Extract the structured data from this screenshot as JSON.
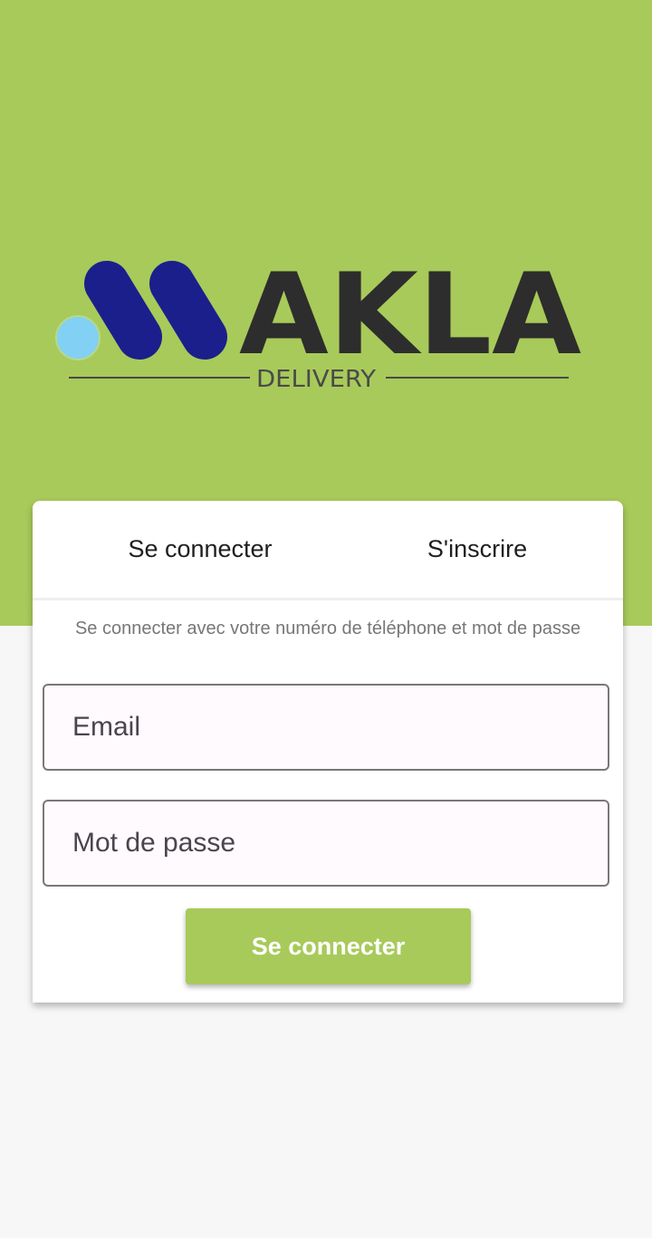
{
  "brand": {
    "name": "AKLA",
    "tagline": "DELIVERY",
    "colors": {
      "primary_green": "#a8ca5a",
      "logo_navy": "#1b1f8c",
      "logo_dot": "#82d0f4",
      "logo_text": "#2d2d2d"
    }
  },
  "tabs": {
    "login_label": "Se connecter",
    "register_label": "S'inscrire"
  },
  "form": {
    "subtitle": "Se connecter avec votre numéro de téléphone et mot de passe",
    "email": {
      "placeholder": "Email",
      "value": ""
    },
    "password": {
      "placeholder": "Mot de passe",
      "value": ""
    },
    "submit_label": "Se connecter"
  }
}
